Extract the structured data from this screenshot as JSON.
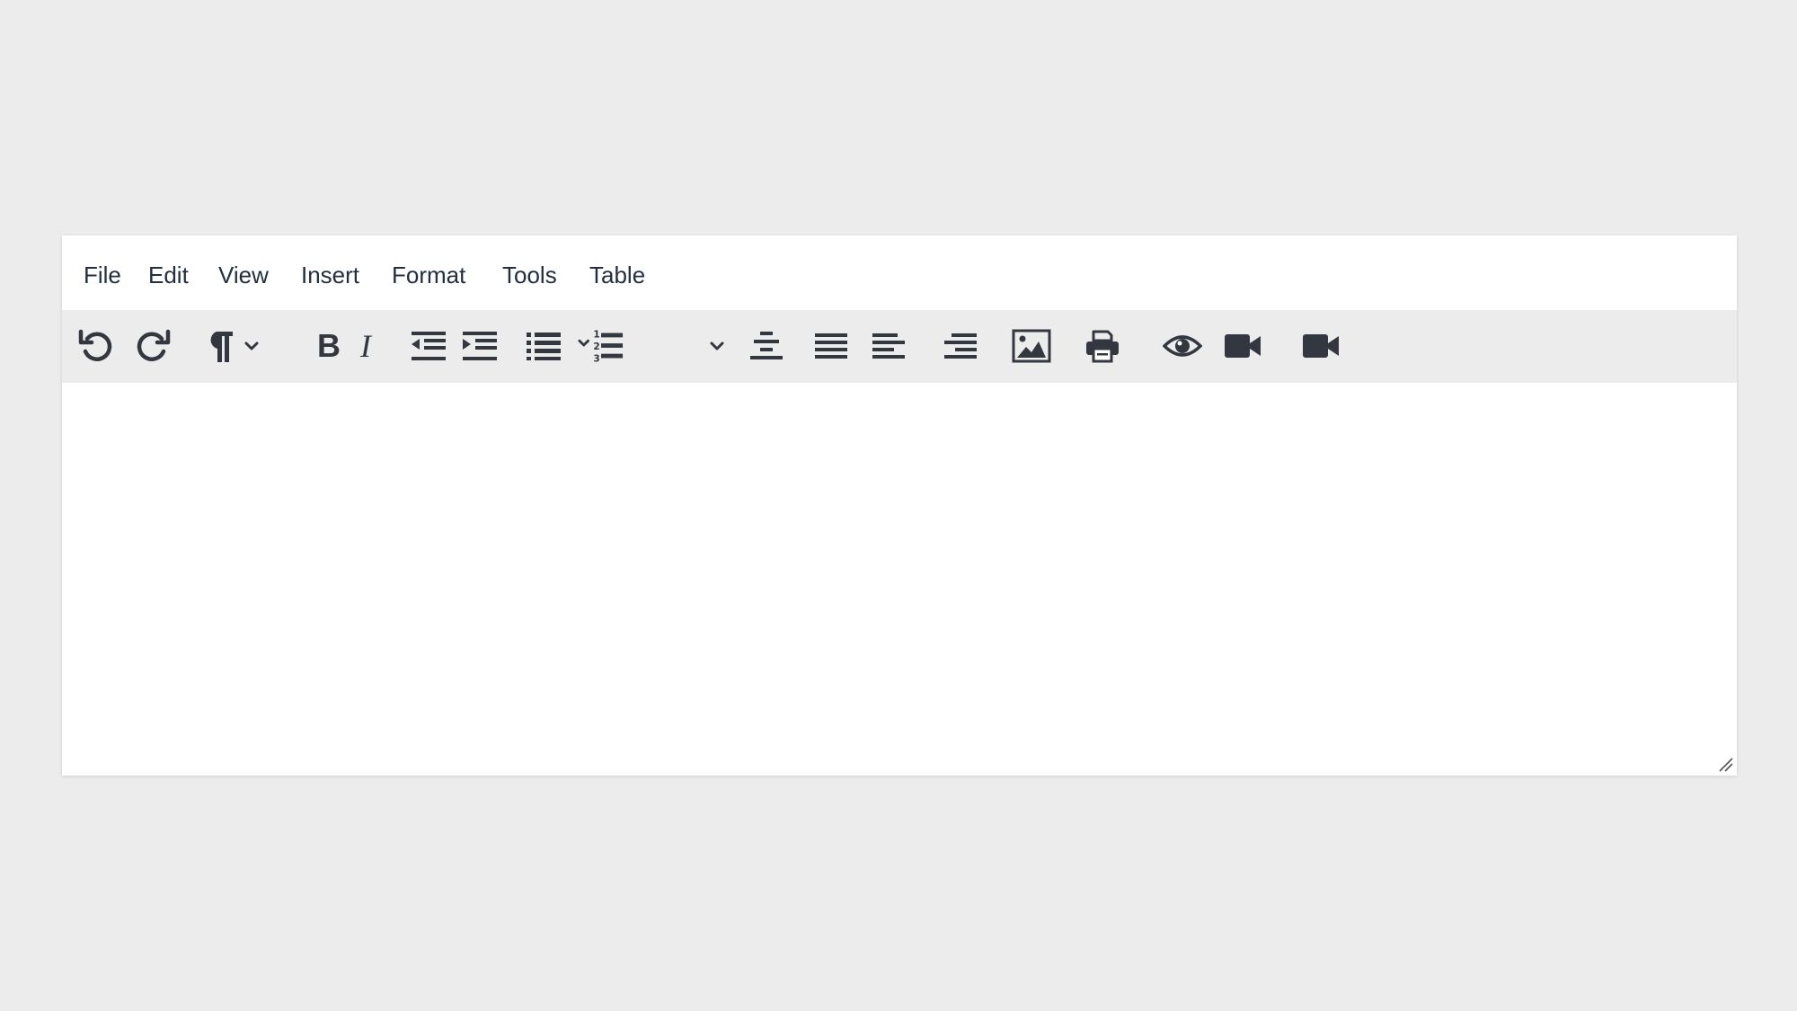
{
  "menubar": {
    "items": [
      {
        "label": "File"
      },
      {
        "label": "Edit"
      },
      {
        "label": "View"
      },
      {
        "label": "Insert"
      },
      {
        "label": "Format"
      },
      {
        "label": "Tools"
      },
      {
        "label": "Table"
      }
    ]
  },
  "toolbar": {
    "icon_color": "#333840",
    "bold_glyph": "B",
    "italic_glyph": "I",
    "buttons": [
      {
        "icon": "undo-icon"
      },
      {
        "icon": "redo-icon"
      },
      {
        "icon": "paragraph-icon"
      },
      {
        "icon": "chevron-down-icon"
      },
      {
        "icon": "bold-icon"
      },
      {
        "icon": "italic-icon"
      },
      {
        "icon": "outdent-icon"
      },
      {
        "icon": "indent-icon"
      },
      {
        "icon": "bullet-list-icon"
      },
      {
        "icon": "numbered-list-icon"
      },
      {
        "icon": "chevron-down-icon"
      },
      {
        "icon": "align-center-icon"
      },
      {
        "icon": "align-justify-icon"
      },
      {
        "icon": "align-left-icon"
      },
      {
        "icon": "align-right-icon"
      },
      {
        "icon": "image-icon"
      },
      {
        "icon": "print-icon"
      },
      {
        "icon": "preview-eye-icon"
      },
      {
        "icon": "video-camera-icon"
      },
      {
        "icon": "video-camera-icon"
      }
    ]
  },
  "editor": {
    "content": "",
    "background": "#ffffff",
    "page_background": "#ececec",
    "toolbar_background": "#ececec"
  }
}
